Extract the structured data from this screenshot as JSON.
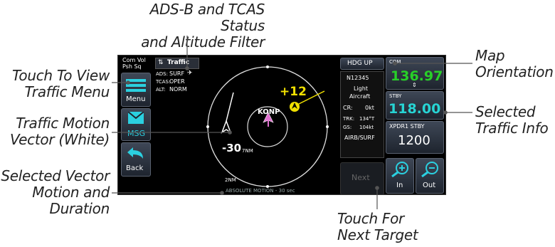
{
  "callouts": {
    "adsb_status_line1": "ADS-B and TCAS Status",
    "adsb_status_line2": "and Altitude Filter",
    "traffic_menu_line1": "Touch To View",
    "traffic_menu_line2": "Traffic Menu",
    "motion_vector_line1": "Traffic Motion",
    "motion_vector_line2": "Vector (White)",
    "selected_vector_line1": "Selected Vector",
    "selected_vector_line2": "Motion and",
    "selected_vector_line3": "Duration",
    "map_orientation_line1": "Map",
    "map_orientation_line2": "Orientation",
    "selected_info_line1": "Selected",
    "selected_info_line2": "Traffic Info",
    "next_target_line1": "Touch For",
    "next_target_line2": "Next Target"
  },
  "left_panel": {
    "com_vol_line1": "Com Vol",
    "com_vol_line2": "Psh Sq",
    "menu_label": "Menu",
    "msg_label": "MSG",
    "back_label": "Back"
  },
  "traffic": {
    "title": "Traffic",
    "ads_label": "ADS:",
    "ads_value": "SURF",
    "tcas_label": "TCAS:",
    "tcas_value": "OPER",
    "alt_label": "ALT:",
    "alt_value": "NORM",
    "ownship_id": "KONP",
    "target_alt_above": "+12",
    "target_alt_below": "-30",
    "ring_outer": "7NM",
    "ring_inner": "2NM",
    "vector_motion": "ABSOLUTE MOTION - 30 sec"
  },
  "info": {
    "orientation": "HDG UP",
    "tail": "N12345",
    "category_line1": "Light",
    "category_line2": "Aircraft",
    "cr_label": "CR:",
    "cr_value": "0kt",
    "trk_label": "TRK:",
    "trk_value": "134°T",
    "gs_label": "GS:",
    "gs_value": "104kt",
    "mode": "AIRB/SURF",
    "next_label": "Next"
  },
  "radio": {
    "com_label": "COM",
    "com_freq": "136.97",
    "stby_label": "STBY",
    "stby_freq": "118.00",
    "xpdr_label": "XPDR1 STBY",
    "squawk": "1200",
    "zoom_in_label": "In",
    "zoom_out_label": "Out"
  },
  "colors": {
    "cyan": "#27d4d4",
    "green": "#28d028",
    "traffic_yellow": "#f0e000",
    "ownship_magenta": "#e070d0"
  }
}
